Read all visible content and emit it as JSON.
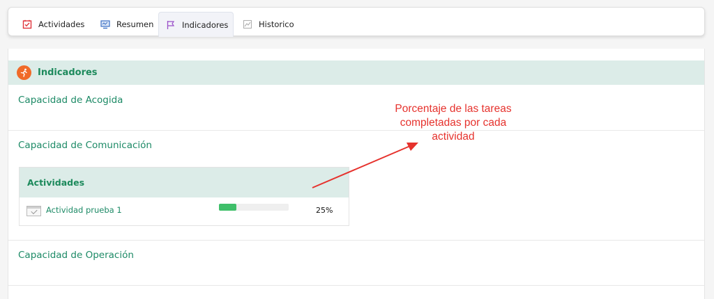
{
  "tabs": [
    {
      "label": "Actividades",
      "icon": "calendar-check-icon"
    },
    {
      "label": "Resumen",
      "icon": "monitor-icon"
    },
    {
      "label": "Indicadores",
      "icon": "flag-icon",
      "active": true
    },
    {
      "label": "Historico",
      "icon": "chart-icon"
    }
  ],
  "panel": {
    "title": "Indicadores",
    "header_icon": "runner-icon"
  },
  "capacidades": [
    "Capacidad de Acogida",
    "Capacidad de Comunicación",
    "Capacidad de Operación"
  ],
  "activities": {
    "header": "Actividades",
    "items": [
      {
        "name": "Actividad prueba 1",
        "percent_label": "25%",
        "progress": 0.25
      }
    ]
  },
  "annotation": {
    "line1": "Porcentaje de las tareas",
    "line2": "completadas por cada",
    "line3": "actividad"
  },
  "colors": {
    "accent_green": "#1d8a66",
    "header_bg": "#dcece8",
    "progress": "#3fbf6a",
    "annotation_red": "#e6322d",
    "header_icon_bg": "#f06a28"
  }
}
